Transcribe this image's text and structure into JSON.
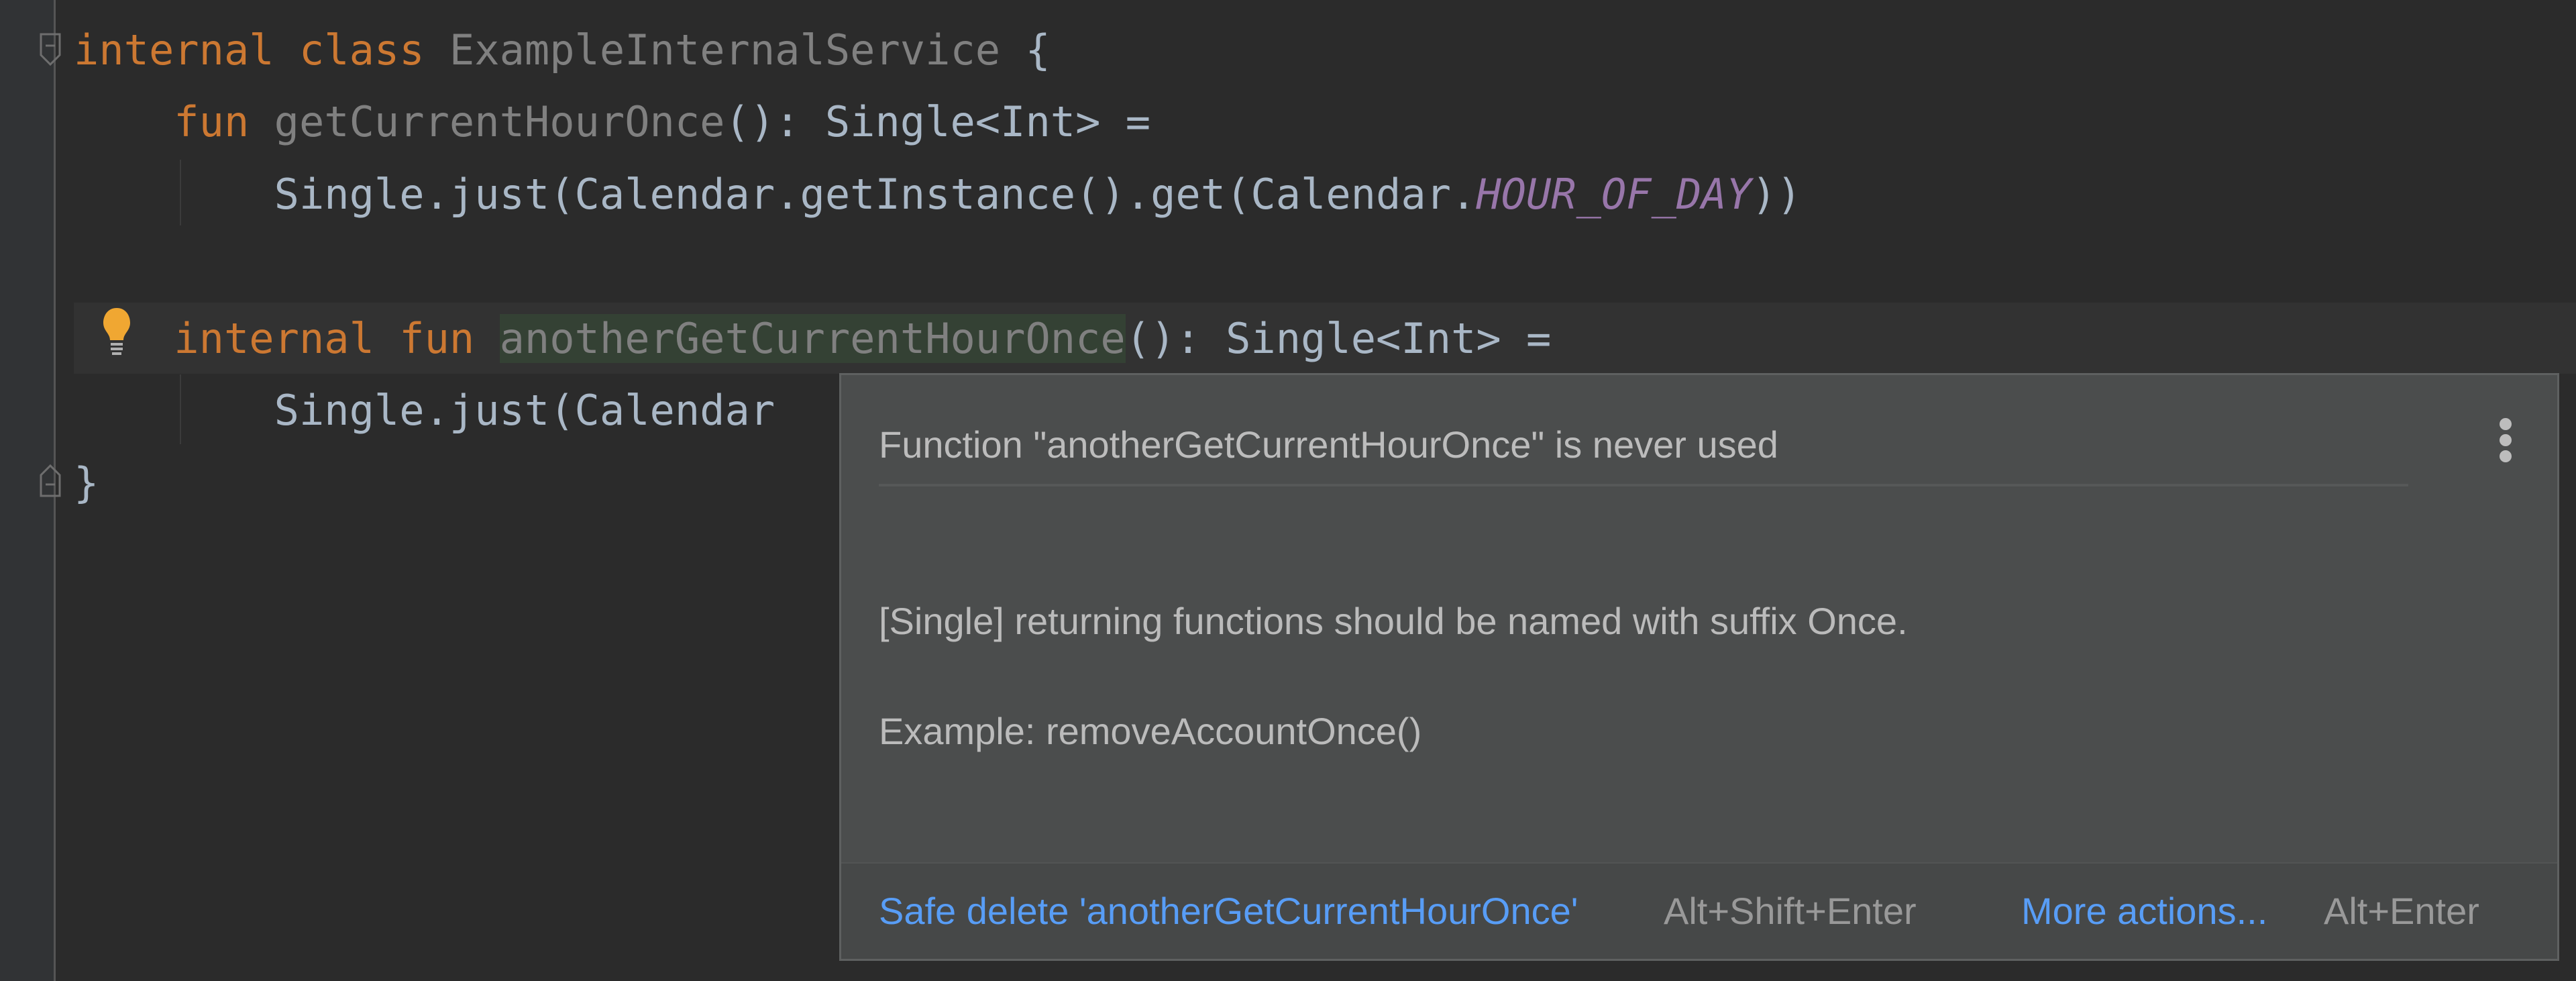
{
  "editor": {
    "lines": [
      {
        "tokens": [
          {
            "text": "internal",
            "kind": "keyword"
          },
          {
            "text": " ",
            "kind": "plain"
          },
          {
            "text": "class",
            "kind": "keyword"
          },
          {
            "text": " ",
            "kind": "plain"
          },
          {
            "text": "ExampleInternalService",
            "kind": "unused"
          },
          {
            "text": " {",
            "kind": "plain"
          }
        ]
      },
      {
        "tokens": [
          {
            "text": "    fun",
            "kind": "keyword"
          },
          {
            "text": " ",
            "kind": "plain"
          },
          {
            "text": "getCurrentHourOnce",
            "kind": "unused"
          },
          {
            "text": "(): Single<Int> =",
            "kind": "plain"
          }
        ]
      },
      {
        "tokens": [
          {
            "text": "        Single.just(Calendar.getInstance().get(Calendar.",
            "kind": "plain"
          },
          {
            "text": "HOUR_OF_DAY",
            "kind": "constant"
          },
          {
            "text": "))",
            "kind": "plain"
          }
        ]
      },
      {
        "tokens": []
      },
      {
        "tokens": [
          {
            "text": "    internal",
            "kind": "keyword"
          },
          {
            "text": " ",
            "kind": "plain"
          },
          {
            "text": "fun",
            "kind": "keyword"
          },
          {
            "text": " ",
            "kind": "plain"
          },
          {
            "text": "anotherGetCurrentHourOnce",
            "kind": "unused-highlight"
          },
          {
            "text": "(): Single<Int> =",
            "kind": "plain"
          }
        ]
      },
      {
        "tokens": [
          {
            "text": "        Single.just(Calendar",
            "kind": "plain"
          }
        ]
      },
      {
        "tokens": [
          {
            "text": "}",
            "kind": "plain"
          }
        ]
      }
    ],
    "intention_icon": "lightbulb-icon"
  },
  "popup": {
    "title": "Function \"anotherGetCurrentHourOnce\" is never used",
    "menu_icon": "more-vertical-icon",
    "description": "[Single] returning functions should be named with suffix Once.",
    "example": "Example: removeAccountOnce()",
    "actions": [
      {
        "label": "Safe delete 'anotherGetCurrentHourOnce'",
        "shortcut": "Alt+Shift+Enter"
      },
      {
        "label": "More actions...",
        "shortcut": "Alt+Enter"
      }
    ]
  },
  "colors": {
    "background": "#2b2b2b",
    "keyword": "#cc7832",
    "unused": "#808080",
    "constant": "#9876aa",
    "plain": "#a9b7c6",
    "link": "#589df6",
    "unused_highlight_bg": "#344134"
  }
}
